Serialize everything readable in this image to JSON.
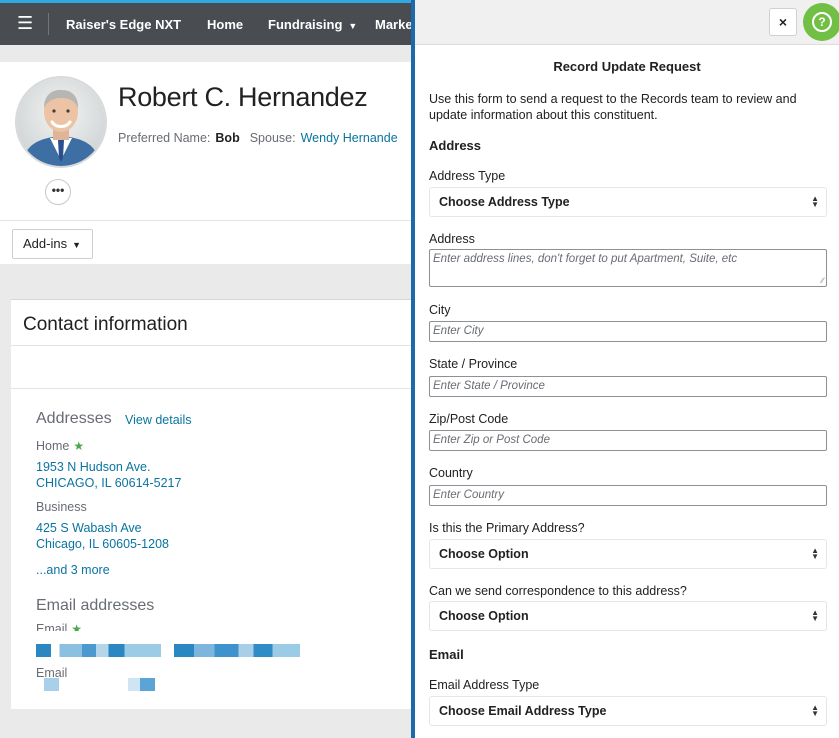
{
  "nav": {
    "app_name": "Raiser's Edge NXT",
    "home": "Home",
    "fundraising": "Fundraising",
    "marketing_truncated": "Marke"
  },
  "constituent": {
    "name": "Robert C. Hernandez",
    "preferred_name_label": "Preferred Name:",
    "preferred_name": "Bob",
    "spouse_label": "Spouse:",
    "spouse": "Wendy Hernande",
    "more_label": "•••"
  },
  "addins": {
    "label": "Add-ins"
  },
  "contact": {
    "title": "Contact information",
    "addresses_heading": "Addresses",
    "view_details": "View details",
    "addresses": [
      {
        "type": "Home",
        "primary": true,
        "line1": "1953 N Hudson Ave.",
        "line2": "CHICAGO, IL  60614-5217"
      },
      {
        "type": "Business",
        "primary": false,
        "line1": "425 S Wabash Ave",
        "line2": "Chicago, IL  60605-1208"
      }
    ],
    "more_link": "...and 3 more",
    "email_heading": "Email addresses",
    "email_label_1": "Email",
    "email_label_2": "Email"
  },
  "panel": {
    "close_icon": "×",
    "help_icon": "?",
    "title": "Record Update Request",
    "intro": "Use this form to send a request to the Records team to review and update information about this constituent.",
    "address_section": "Address",
    "address_type_label": "Address Type",
    "address_type_value": "Choose Address Type",
    "address_label": "Address",
    "address_placeholder": "Enter address lines, don't forget to put Apartment, Suite, etc",
    "city_label": "City",
    "city_placeholder": "Enter City",
    "state_label": "State / Province",
    "state_placeholder": "Enter State / Province",
    "zip_label": "Zip/Post Code",
    "zip_placeholder": "Enter Zip or Post Code",
    "country_label": "Country",
    "country_placeholder": "Enter Country",
    "primary_label": "Is this the Primary Address?",
    "primary_value": "Choose Option",
    "correspondence_label": "Can we send correspondence to this address?",
    "correspondence_value": "Choose Option",
    "email_section": "Email",
    "email_type_label": "Email Address Type",
    "email_type_value": "Choose Email Address Type"
  },
  "colors": {
    "nav_bg": "#494c51",
    "link": "#0974a1",
    "accent_green": "#71bf44",
    "divider_blue": "#1c6aab"
  }
}
